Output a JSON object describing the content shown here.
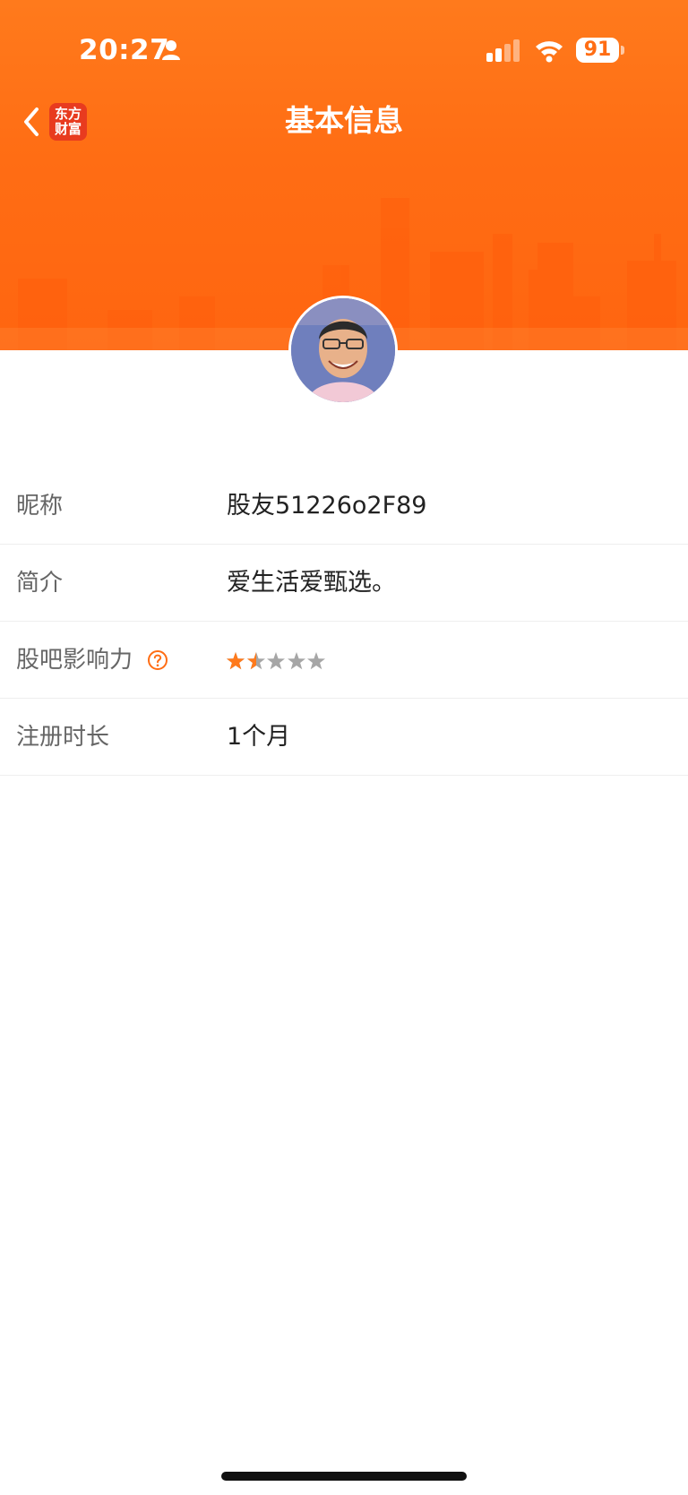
{
  "status_bar": {
    "time": "20:27",
    "battery": "91",
    "icons": [
      "person-icon",
      "signal-icon",
      "wifi-icon",
      "battery-icon"
    ]
  },
  "nav": {
    "title": "基本信息",
    "logo_line1": "东方",
    "logo_line2": "财富",
    "back_icon": "chevron-left-icon"
  },
  "profile": {
    "avatar": "user-avatar-photo"
  },
  "info_rows": [
    {
      "label": "昵称",
      "value": "股友51226o2F89"
    },
    {
      "label": "简介",
      "value": "爱生活爱甄选。"
    },
    {
      "label": "股吧影响力",
      "rating": 1.5,
      "max": 5,
      "help_icon": "question-circle-icon"
    },
    {
      "label": "注册时长",
      "value": "1个月"
    }
  ],
  "colors": {
    "brand": "#ff6d14",
    "star_filled": "#ff7a1c",
    "star_empty": "#a6a6a6",
    "logo_red": "#e83b1f"
  }
}
